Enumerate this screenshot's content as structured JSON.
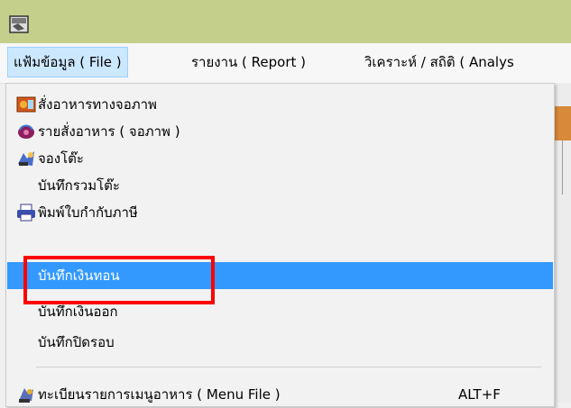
{
  "window": {
    "app_icon": "app-window-icon"
  },
  "menubar": {
    "items": [
      {
        "label": "แฟ้มข้อมูล ( File )",
        "active": true
      },
      {
        "label": "รายงาน ( Report )",
        "active": false
      },
      {
        "label": "วิเคราะห์ / สถิติ ( Analys",
        "active": false
      }
    ]
  },
  "dropdown": {
    "items": [
      {
        "label": "สั่งอาหารทางจอภาพ",
        "icon": "food-order-icon"
      },
      {
        "label": "รายสั่งอาหาร ( จอภาพ )",
        "icon": "order-list-icon"
      },
      {
        "label": "จองโต๊ะ",
        "icon": "table-booking-icon"
      },
      {
        "label": "บันทึกรวมโต๊ะ",
        "icon": ""
      },
      {
        "label": "พิมพ์ใบกำกับภาษี",
        "icon": "printer-icon"
      },
      {
        "label": "บันทึกเงินทอน",
        "icon": "",
        "highlighted": true
      },
      {
        "label": "บันทึกเงินออก",
        "icon": ""
      },
      {
        "label": "บันทึกปิดรอบ",
        "icon": ""
      },
      {
        "label": "ทะเบียนรายการเมนูอาหาร ( Menu File )",
        "icon": "menu-file-icon",
        "shortcut": "ALT+F"
      }
    ]
  },
  "annotation": {
    "highlight_color": "#ff0000"
  }
}
